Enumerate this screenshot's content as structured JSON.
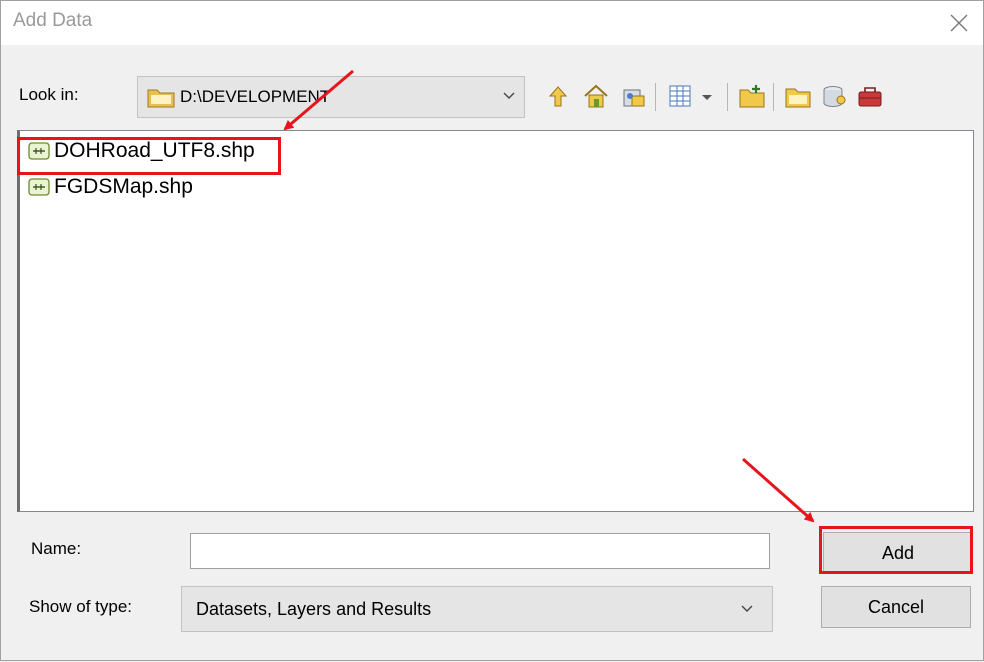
{
  "dialog": {
    "title": "Add Data",
    "look_in_label": "Look in:",
    "look_in_value": "D:\\DEVELOPMENT",
    "name_label": "Name:",
    "name_value": "",
    "show_type_label": "Show of type:",
    "show_type_value": "Datasets, Layers and Results",
    "add_button": "Add",
    "cancel_button": "Cancel"
  },
  "files": [
    {
      "name": "DOHRoad_UTF8.shp",
      "icon": "line-shapefile-icon"
    },
    {
      "name": "FGDSMap.shp",
      "icon": "line-shapefile-icon"
    }
  ],
  "toolbar": [
    "up-one-level-icon",
    "home-icon",
    "connect-folder-icon",
    "view-list-icon",
    "view-dropdown-icon",
    "new-folder-icon",
    "folder-icon",
    "database-icon",
    "toolbox-icon"
  ],
  "colors": {
    "highlight": "#e8141b",
    "folder": "#e8c050"
  }
}
